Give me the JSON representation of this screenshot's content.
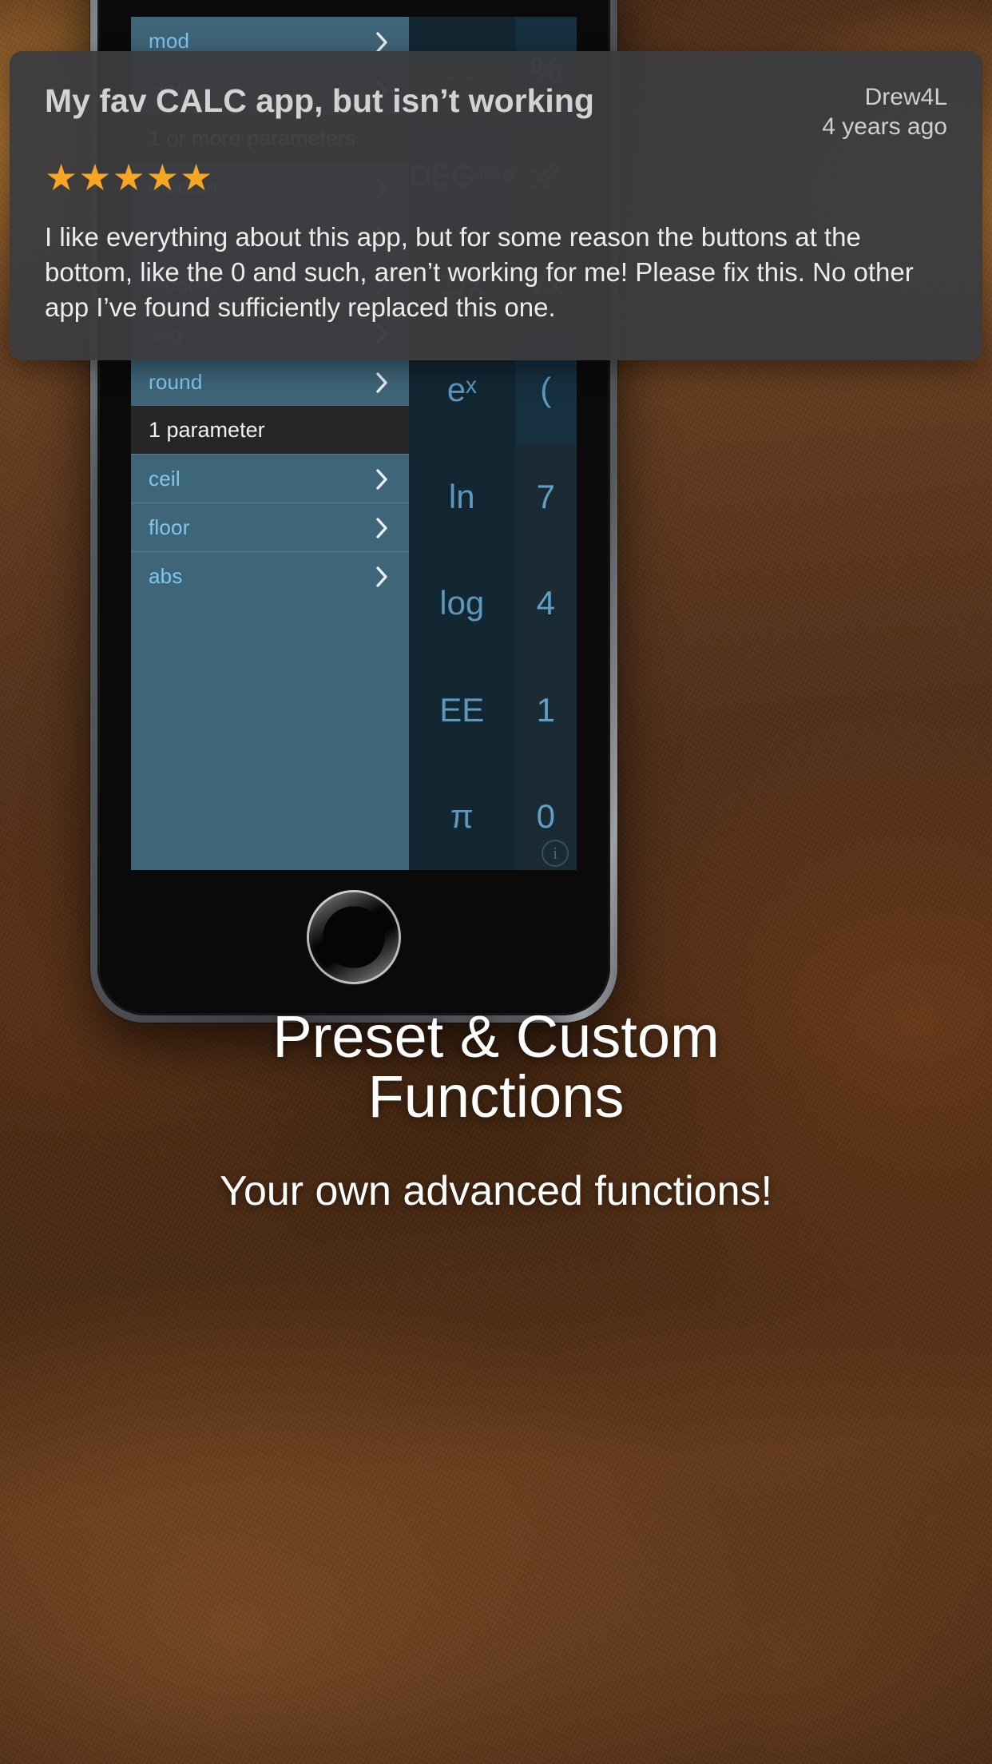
{
  "review": {
    "title": "My fav CALC app, but isn’t working",
    "author": "Drew4L",
    "date": "4 years ago",
    "stars": "★★★★★",
    "star_count": 5,
    "star_color": "#f5a623",
    "body": "I like everything about this app, but for some reason the buttons at the bottom, like the 0 and such, aren’t working for me! Please fix this. No other app I’ve found sufficiently replaced this one."
  },
  "app": {
    "function_list": [
      {
        "type": "row",
        "label": "mod",
        "chevron": "chevron-right-icon"
      },
      {
        "type": "row",
        "label": "sind",
        "chevron": "chevron-right-icon"
      },
      {
        "type": "header",
        "label": "1 or more parameters"
      },
      {
        "type": "row",
        "label": "median",
        "chevron": "chevron-right-icon"
      },
      {
        "type": "row",
        "label": "stddev",
        "chevron": "chevron-right-icon"
      },
      {
        "type": "row",
        "label": "stddevs",
        "chevron": "chevron-right-icon"
      },
      {
        "type": "row",
        "label": "avg",
        "chevron": "chevron-right-icon"
      },
      {
        "type": "row",
        "label": "round",
        "chevron": "chevron-right-icon"
      },
      {
        "type": "header",
        "label": "1 parameter"
      },
      {
        "type": "row",
        "label": "ceil",
        "chevron": "chevron-right-icon"
      },
      {
        "type": "row",
        "label": "floor",
        "chevron": "chevron-right-icon"
      },
      {
        "type": "row",
        "label": "abs",
        "chevron": "chevron-right-icon"
      }
    ],
    "keypad": [
      {
        "label": "…",
        "name": "more-key",
        "style": "dark"
      },
      {
        "label": "%",
        "name": "percent-key",
        "style": "mid"
      },
      {
        "label": "DEG",
        "sub": "/RAD",
        "name": "deg-rad-toggle",
        "style": "mid"
      },
      {
        "label": "x²",
        "name": "square-key",
        "style": "dark"
      },
      {
        "label": "1/x",
        "name": "reciprocal-key",
        "style": "dark"
      },
      {
        "label": "√x",
        "name": "sqrt-key",
        "style": "dark"
      },
      {
        "label": "eˣ",
        "name": "exp-key",
        "style": "dark"
      },
      {
        "label": "(",
        "name": "open-paren-key",
        "style": "mid"
      },
      {
        "label": "ln",
        "name": "ln-key",
        "style": "dark"
      },
      {
        "label": "7",
        "name": "digit-7-key",
        "style": "num"
      },
      {
        "label": "log",
        "name": "log-key",
        "style": "dark"
      },
      {
        "label": "4",
        "name": "digit-4-key",
        "style": "num"
      },
      {
        "label": "EE",
        "name": "ee-key",
        "style": "dark"
      },
      {
        "label": "1",
        "name": "digit-1-key",
        "style": "num"
      },
      {
        "label": "π",
        "name": "pi-key",
        "style": "dark"
      },
      {
        "label": "0",
        "name": "digit-0-key",
        "style": "num"
      }
    ],
    "info_glyph": "i",
    "colors": {
      "list_bg": "#3f6578",
      "list_label": "#7ec8ef",
      "header_bg": "#262626",
      "keypad_bg": "#12242e",
      "key_text": "#5d97bd"
    }
  },
  "caption": {
    "title_line1": "Preset & Custom",
    "title_line2": "Functions",
    "subtitle": "Your own advanced functions!"
  }
}
